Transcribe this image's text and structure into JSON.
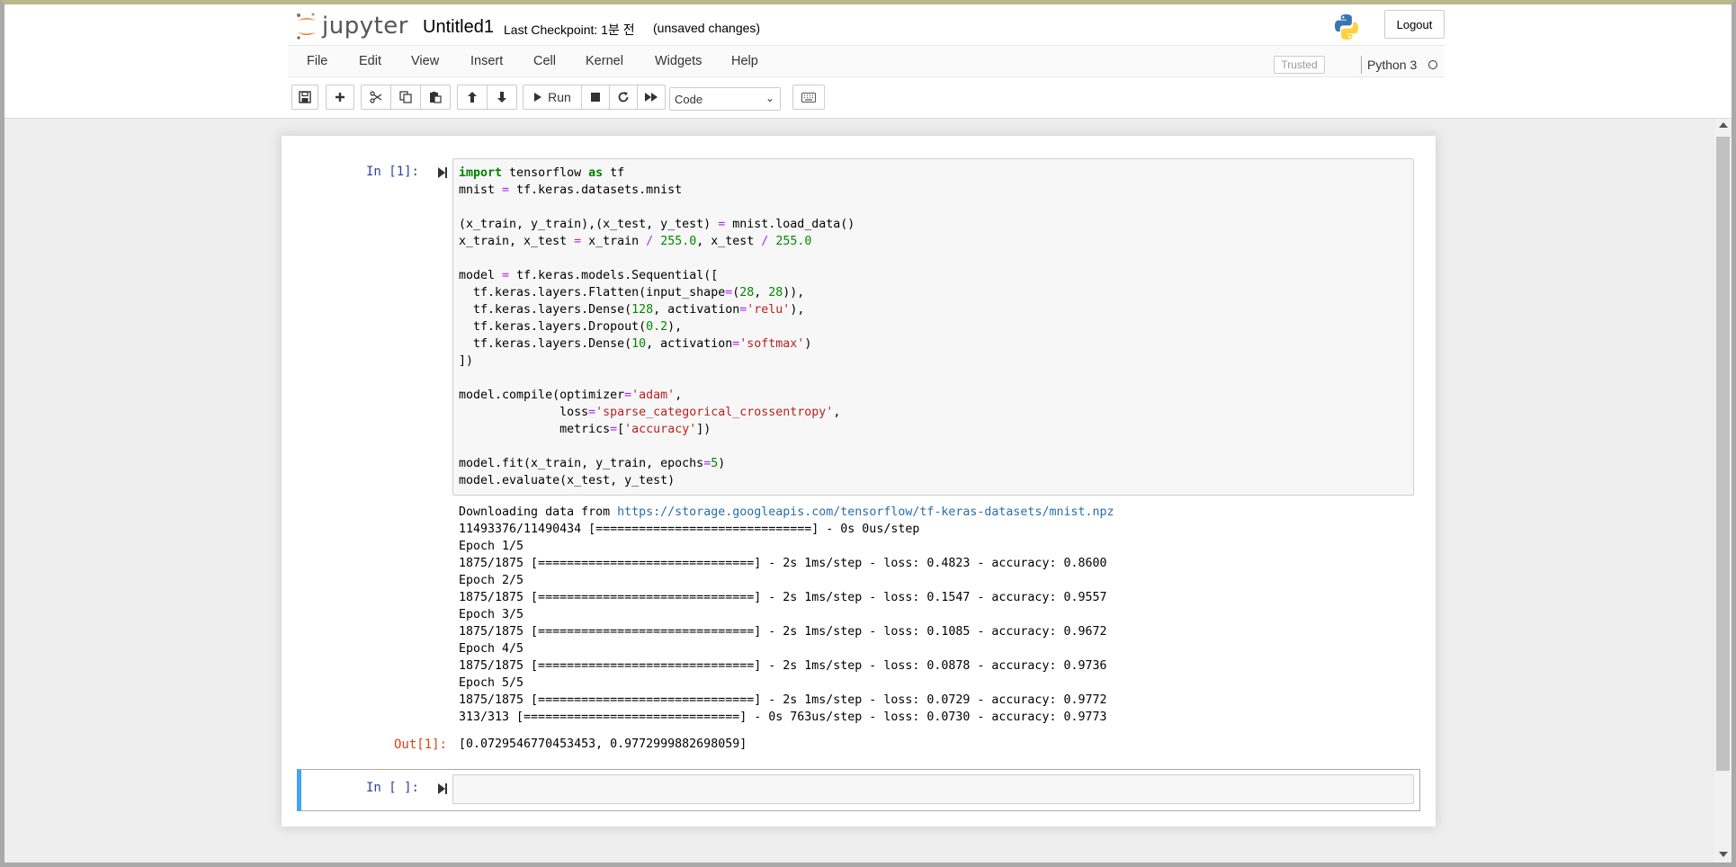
{
  "header": {
    "logo_text": "jupyter",
    "notebook_name": "Untitled1",
    "checkpoint": "Last Checkpoint: 1분 전",
    "autosave_status": "(unsaved changes)",
    "logout_label": "Logout"
  },
  "menu": {
    "items": [
      "File",
      "Edit",
      "View",
      "Insert",
      "Cell",
      "Kernel",
      "Widgets",
      "Help"
    ],
    "trusted_label": "Trusted",
    "kernel_name": "Python 3"
  },
  "toolbar": {
    "run_label": "Run",
    "cell_type": "Code"
  },
  "cells": {
    "cell1": {
      "prompt_in": "In [1]:",
      "prompt_out": "Out[1]:",
      "output_lines": {
        "download_prefix": "Downloading data from ",
        "download_url": "https://storage.googleapis.com/tensorflow/tf-keras-datasets/mnist.npz",
        "rest": "11493376/11490434 [==============================] - 0s 0us/step\nEpoch 1/5\n1875/1875 [==============================] - 2s 1ms/step - loss: 0.4823 - accuracy: 0.8600\nEpoch 2/5\n1875/1875 [==============================] - 2s 1ms/step - loss: 0.1547 - accuracy: 0.9557\nEpoch 3/5\n1875/1875 [==============================] - 2s 1ms/step - loss: 0.1085 - accuracy: 0.9672\nEpoch 4/5\n1875/1875 [==============================] - 2s 1ms/step - loss: 0.0878 - accuracy: 0.9736\nEpoch 5/5\n1875/1875 [==============================] - 2s 1ms/step - loss: 0.0729 - accuracy: 0.9772\n313/313 [==============================] - 0s 763us/step - loss: 0.0730 - accuracy: 0.9773"
      },
      "result": "[0.0729546770453453, 0.9772999882698059]"
    },
    "cell2": {
      "prompt_in": "In [ ]:"
    }
  },
  "code_tokens": [
    [
      [
        "kw",
        "import"
      ],
      [
        "t",
        " tensorflow "
      ],
      [
        "kw",
        "as"
      ],
      [
        "t",
        " tf"
      ]
    ],
    [
      [
        "t",
        "mnist "
      ],
      [
        "op",
        "="
      ],
      [
        "t",
        " tf.keras.datasets.mnist"
      ]
    ],
    [],
    [
      [
        "t",
        "(x_train, y_train),(x_test, y_test) "
      ],
      [
        "op",
        "="
      ],
      [
        "t",
        " mnist.load_data()"
      ]
    ],
    [
      [
        "t",
        "x_train, x_test "
      ],
      [
        "op",
        "="
      ],
      [
        "t",
        " x_train "
      ],
      [
        "op",
        "/"
      ],
      [
        "t",
        " "
      ],
      [
        "num",
        "255.0"
      ],
      [
        "t",
        ", x_test "
      ],
      [
        "op",
        "/"
      ],
      [
        "t",
        " "
      ],
      [
        "num",
        "255.0"
      ]
    ],
    [],
    [
      [
        "t",
        "model "
      ],
      [
        "op",
        "="
      ],
      [
        "t",
        " tf.keras.models.Sequential(["
      ]
    ],
    [
      [
        "t",
        "  tf.keras.layers.Flatten(input_shape"
      ],
      [
        "op",
        "="
      ],
      [
        "t",
        "("
      ],
      [
        "num",
        "28"
      ],
      [
        "t",
        ", "
      ],
      [
        "num",
        "28"
      ],
      [
        "t",
        ")),"
      ]
    ],
    [
      [
        "t",
        "  tf.keras.layers.Dense("
      ],
      [
        "num",
        "128"
      ],
      [
        "t",
        ", activation"
      ],
      [
        "op",
        "="
      ],
      [
        "str",
        "'relu'"
      ],
      [
        "t",
        "),"
      ]
    ],
    [
      [
        "t",
        "  tf.keras.layers.Dropout("
      ],
      [
        "num",
        "0.2"
      ],
      [
        "t",
        "),"
      ]
    ],
    [
      [
        "t",
        "  tf.keras.layers.Dense("
      ],
      [
        "num",
        "10"
      ],
      [
        "t",
        ", activation"
      ],
      [
        "op",
        "="
      ],
      [
        "str",
        "'softmax'"
      ],
      [
        "t",
        ")"
      ]
    ],
    [
      [
        "t",
        "])"
      ]
    ],
    [],
    [
      [
        "t",
        "model.compile(optimizer"
      ],
      [
        "op",
        "="
      ],
      [
        "str",
        "'adam'"
      ],
      [
        "t",
        ","
      ]
    ],
    [
      [
        "t",
        "              loss"
      ],
      [
        "op",
        "="
      ],
      [
        "str",
        "'sparse_categorical_crossentropy'"
      ],
      [
        "t",
        ","
      ]
    ],
    [
      [
        "t",
        "              metrics"
      ],
      [
        "op",
        "="
      ],
      [
        "t",
        "["
      ],
      [
        "str",
        "'accuracy'"
      ],
      [
        "t",
        "])"
      ]
    ],
    [],
    [
      [
        "t",
        "model.fit(x_train, y_train, epochs"
      ],
      [
        "op",
        "="
      ],
      [
        "num",
        "5"
      ],
      [
        "t",
        ")"
      ]
    ],
    [
      [
        "t",
        "model.evaluate(x_test, y_test)"
      ]
    ]
  ],
  "icons": {
    "save": "floppy-disk-icon",
    "insert": "plus-icon",
    "cut": "scissors-icon",
    "copy": "copy-icon",
    "paste": "paste-icon",
    "move_up": "arrow-up-icon",
    "move_down": "arrow-down-icon",
    "run": "play-icon",
    "interrupt": "stop-icon",
    "restart": "refresh-icon",
    "restart_run_all": "fast-forward-icon",
    "command_palette": "keyboard-icon"
  },
  "colors": {
    "jupyter_orange": "#f37726",
    "prompt_in": "#303f9f",
    "prompt_out": "#d84315",
    "selected_cell_border": "#42a5f5",
    "link": "#296eaa"
  }
}
